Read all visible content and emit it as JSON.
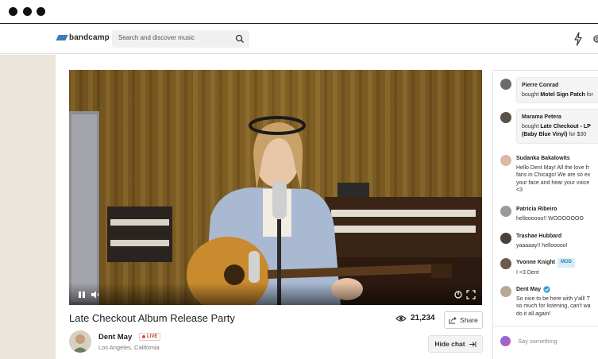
{
  "window": {
    "controls": [
      "close",
      "minimize",
      "maximize"
    ]
  },
  "header": {
    "logo_text": "bandcamp",
    "search": {
      "placeholder": "Search and discover music"
    },
    "icons": [
      "search-icon",
      "bolt-icon",
      "gear-icon"
    ]
  },
  "stream": {
    "title": "Late Checkout Album Release Party",
    "viewer_count": "21,234",
    "share_label": "Share",
    "hide_chat_label": "Hide chat",
    "artist": {
      "name": "Dent May",
      "live_label": "LIVE",
      "location": "Los Angeles, California"
    },
    "player_icons": [
      "pause-icon",
      "volume-icon",
      "airplay-icon",
      "fullscreen-icon"
    ]
  },
  "chat": {
    "purchases": [
      {
        "name": "Pierre Conrad",
        "verb": "bought",
        "item": "Motel Sign Patch",
        "suffix": "for"
      },
      {
        "name": "Marama Petera",
        "verb": "bought",
        "item": "Late Checkout - LP",
        "item2": "(Baby Blue Vinyl)",
        "suffix": "for $30"
      }
    ],
    "messages": [
      {
        "name": "Sudanka Bakalowits",
        "lines": [
          "Hello Dent May! All the love fr",
          "fans in Chicago! We are so ex",
          "your face and hear your voice",
          "<3"
        ]
      },
      {
        "name": "Patricia Ribeiro",
        "lines": [
          "helloooooo!! WOOOOOOO"
        ]
      },
      {
        "name": "Trashae Hubbard",
        "lines": [
          "yaaaaay!! hellooooo!"
        ]
      },
      {
        "name": "Yvonne Knight",
        "badge": "MOD",
        "lines": [
          "I <3 Dent"
        ]
      },
      {
        "name": "Dent May",
        "verified": true,
        "lines": [
          "So nice to be here with y'all! T",
          "so much for listening, can't wa",
          "do it all again!"
        ]
      }
    ],
    "input_placeholder": "Say something"
  },
  "colors": {
    "brand_blue": "#3d7eb8",
    "live_red": "#e0483a",
    "mod_blue": "#2f7fb0",
    "verified_blue": "#3aa0d8"
  }
}
